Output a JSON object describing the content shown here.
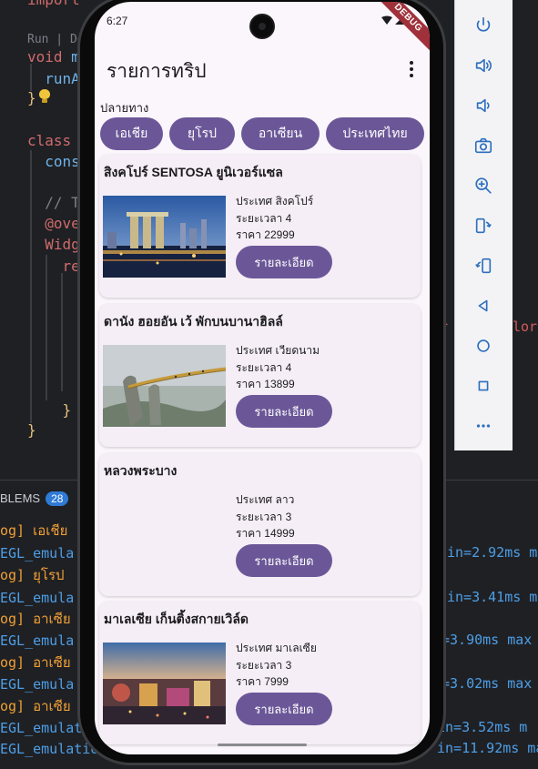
{
  "ide": {
    "code_lines": [
      {
        "pre": "import",
        "cls": "kw"
      },
      {
        "codelens": "Run | Deb"
      },
      {
        "kw": "void",
        "rest": " m"
      },
      {
        "rest": "  runA"
      },
      {
        "rest": "}"
      },
      {
        "kw": "class"
      },
      {
        "rest": "  cons"
      },
      {
        "cm": "  // T"
      },
      {
        "kw": "  @ove"
      },
      {
        "kw": "  Widg"
      },
      {
        "kw": "    re"
      },
      {
        "rest": "      );"
      },
      {
        "rest": "    }"
      },
      {
        "rest": "}"
      }
    ],
    "right_fragment": "r",
    "right_fragment2": "lors",
    "problems_label": "BLEMS",
    "problems_count": "28",
    "log_lines": [
      {
        "text": "og] เอเชีย",
        "type": "orange"
      },
      {
        "text": "EGL_emula",
        "type": "blue",
        "right": "in=2.92ms m"
      },
      {
        "text": "og] ยุโรป",
        "type": "orange"
      },
      {
        "text": "EGL_emula",
        "type": "blue",
        "right": "in=3.41ms m"
      },
      {
        "text": "og] อาเซีย",
        "type": "orange"
      },
      {
        "text": "EGL_emula",
        "type": "blue",
        "right": "=3.90ms max"
      },
      {
        "text": "og] อาเซีย",
        "type": "orange"
      },
      {
        "text": "EGL_emula",
        "type": "blue",
        "right": "=3.02ms max"
      },
      {
        "text": "og] อาเซีย",
        "type": "orange"
      },
      {
        "text": "EGL_emulat",
        "type": "blue",
        "right": "in=3.52ms m"
      },
      {
        "text": "EGL_emulatio",
        "type": "blue",
        "right": "in=11.92ms ma"
      }
    ]
  },
  "toolbar": {
    "buttons": [
      "power-icon",
      "volume-up-icon",
      "volume-down-icon",
      "camera-icon",
      "zoom-in-icon",
      "rotate-left-icon",
      "rotate-right-icon",
      "back-icon",
      "home-icon",
      "overview-icon",
      "more-icon"
    ]
  },
  "status": {
    "time": "6:27",
    "debug": "DEBUG"
  },
  "app": {
    "title": "รายการทริป",
    "filter_label": "ปลายทาง",
    "chips": [
      "เอเชีย",
      "ยุโรป",
      "อาเซียน",
      "ประเทศไทย"
    ],
    "trips": [
      {
        "title": "สิงคโปร์ SENTOSA ยูนิเวอร์แซล",
        "country": "ประเทศ สิงคโปร์",
        "duration": "ระยะเวลา 4",
        "price": "ราคา 22999",
        "button": "รายละเอียด",
        "has_image": true,
        "image": "singapore-marina-bay-image"
      },
      {
        "title": "ดานัง ฮอยอัน เว้ พักบนบานาฮิลล์",
        "country": "ประเทศ เวียดนาม",
        "duration": "ระยะเวลา 4",
        "price": "ราคา 13899",
        "button": "รายละเอียด",
        "has_image": true,
        "image": "golden-bridge-hands-image"
      },
      {
        "title": "หลวงพระบาง",
        "country": "ประเทศ ลาว",
        "duration": "ระยะเวลา 3",
        "price": "ราคา 14999",
        "button": "รายละเอียด",
        "has_image": false,
        "image": ""
      },
      {
        "title": "มาเลเซีย เก็นติ้งสกายเวิล์ด",
        "country": "ประเทศ มาเลเซีย",
        "duration": "ระยะเวลา 3",
        "price": "ราคา 7999",
        "button": "รายละเอียด",
        "has_image": true,
        "image": "genting-theme-park-image"
      }
    ]
  },
  "colors": {
    "accent": "#6b5798",
    "background": "#fbf6fb",
    "card": "#f5eef6"
  }
}
